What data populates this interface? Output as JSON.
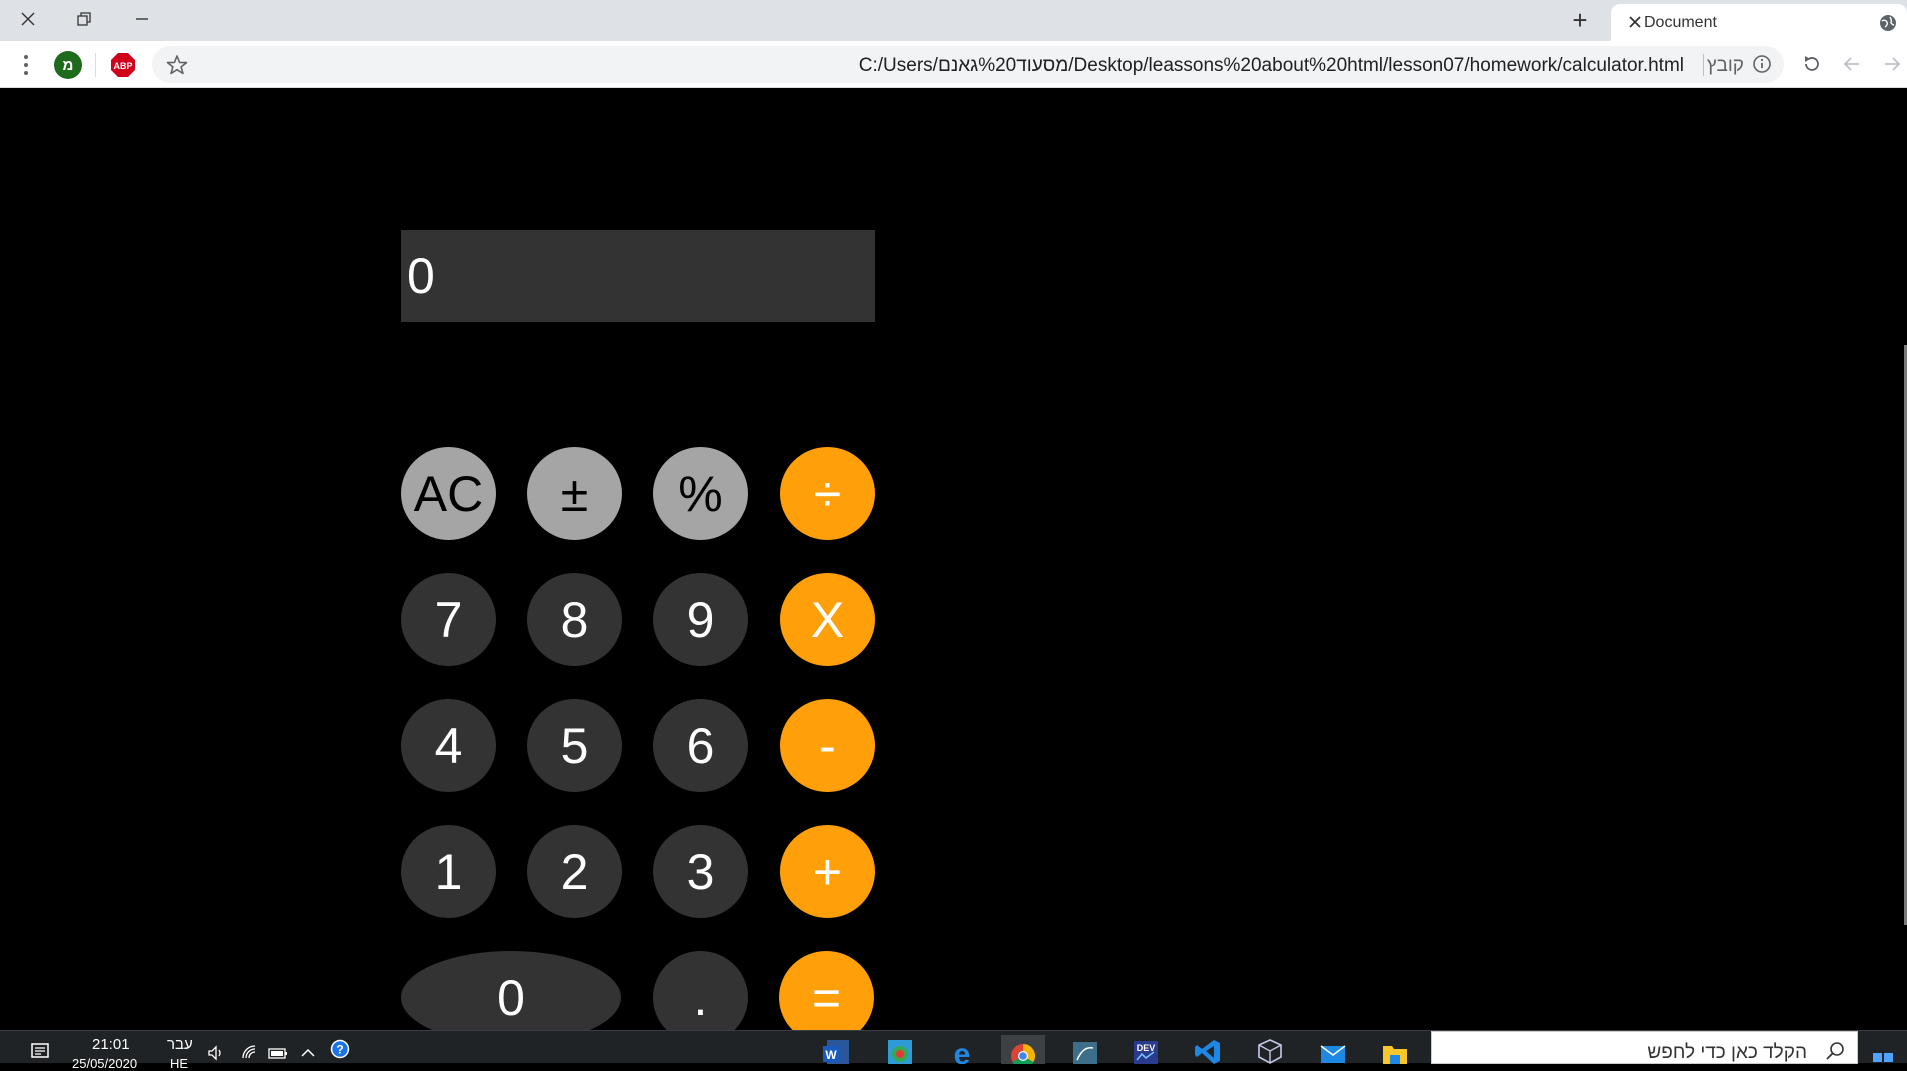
{
  "browser": {
    "tab_title": "Document",
    "new_tab_label": "+",
    "url": "C:/Users/מסעוד%20גאנם/Desktop/leassons%20about%20html/lesson07/homework/calculator.html",
    "url_scheme_label": "קובץ",
    "extension_m_label": "מ"
  },
  "calculator": {
    "display_value": "0",
    "keys": [
      {
        "label": "AC",
        "kind": "fn"
      },
      {
        "label": "±",
        "kind": "fn"
      },
      {
        "label": "%",
        "kind": "fn"
      },
      {
        "label": "÷",
        "kind": "op"
      },
      {
        "label": "7",
        "kind": "num"
      },
      {
        "label": "8",
        "kind": "num"
      },
      {
        "label": "9",
        "kind": "num"
      },
      {
        "label": "X",
        "kind": "op"
      },
      {
        "label": "4",
        "kind": "num"
      },
      {
        "label": "5",
        "kind": "num"
      },
      {
        "label": "6",
        "kind": "num"
      },
      {
        "label": "-",
        "kind": "op"
      },
      {
        "label": "1",
        "kind": "num"
      },
      {
        "label": "2",
        "kind": "num"
      },
      {
        "label": "3",
        "kind": "num"
      },
      {
        "label": "+",
        "kind": "op"
      },
      {
        "label": "0",
        "kind": "num"
      },
      {
        "label": ".",
        "kind": "num"
      },
      {
        "label": "=",
        "kind": "op"
      }
    ],
    "colors": {
      "display_bg": "#333333",
      "function_key": "#a5a5a5",
      "number_key": "#333333",
      "operator_key": "#ff9f0a",
      "page_bg": "#000000"
    }
  },
  "taskbar": {
    "time": "21:01",
    "date": "25/05/2020",
    "language": "עבר",
    "language_sub": "HE",
    "search_placeholder": "הקלד כאן כדי לחפש",
    "apps": [
      "word-icon",
      "chrome-5-icon",
      "edge-icon",
      "chrome-icon",
      "mysql-icon",
      "dev-icon",
      "vscode-icon",
      "virtualbox-icon",
      "mail-icon",
      "file-explorer-icon"
    ]
  }
}
